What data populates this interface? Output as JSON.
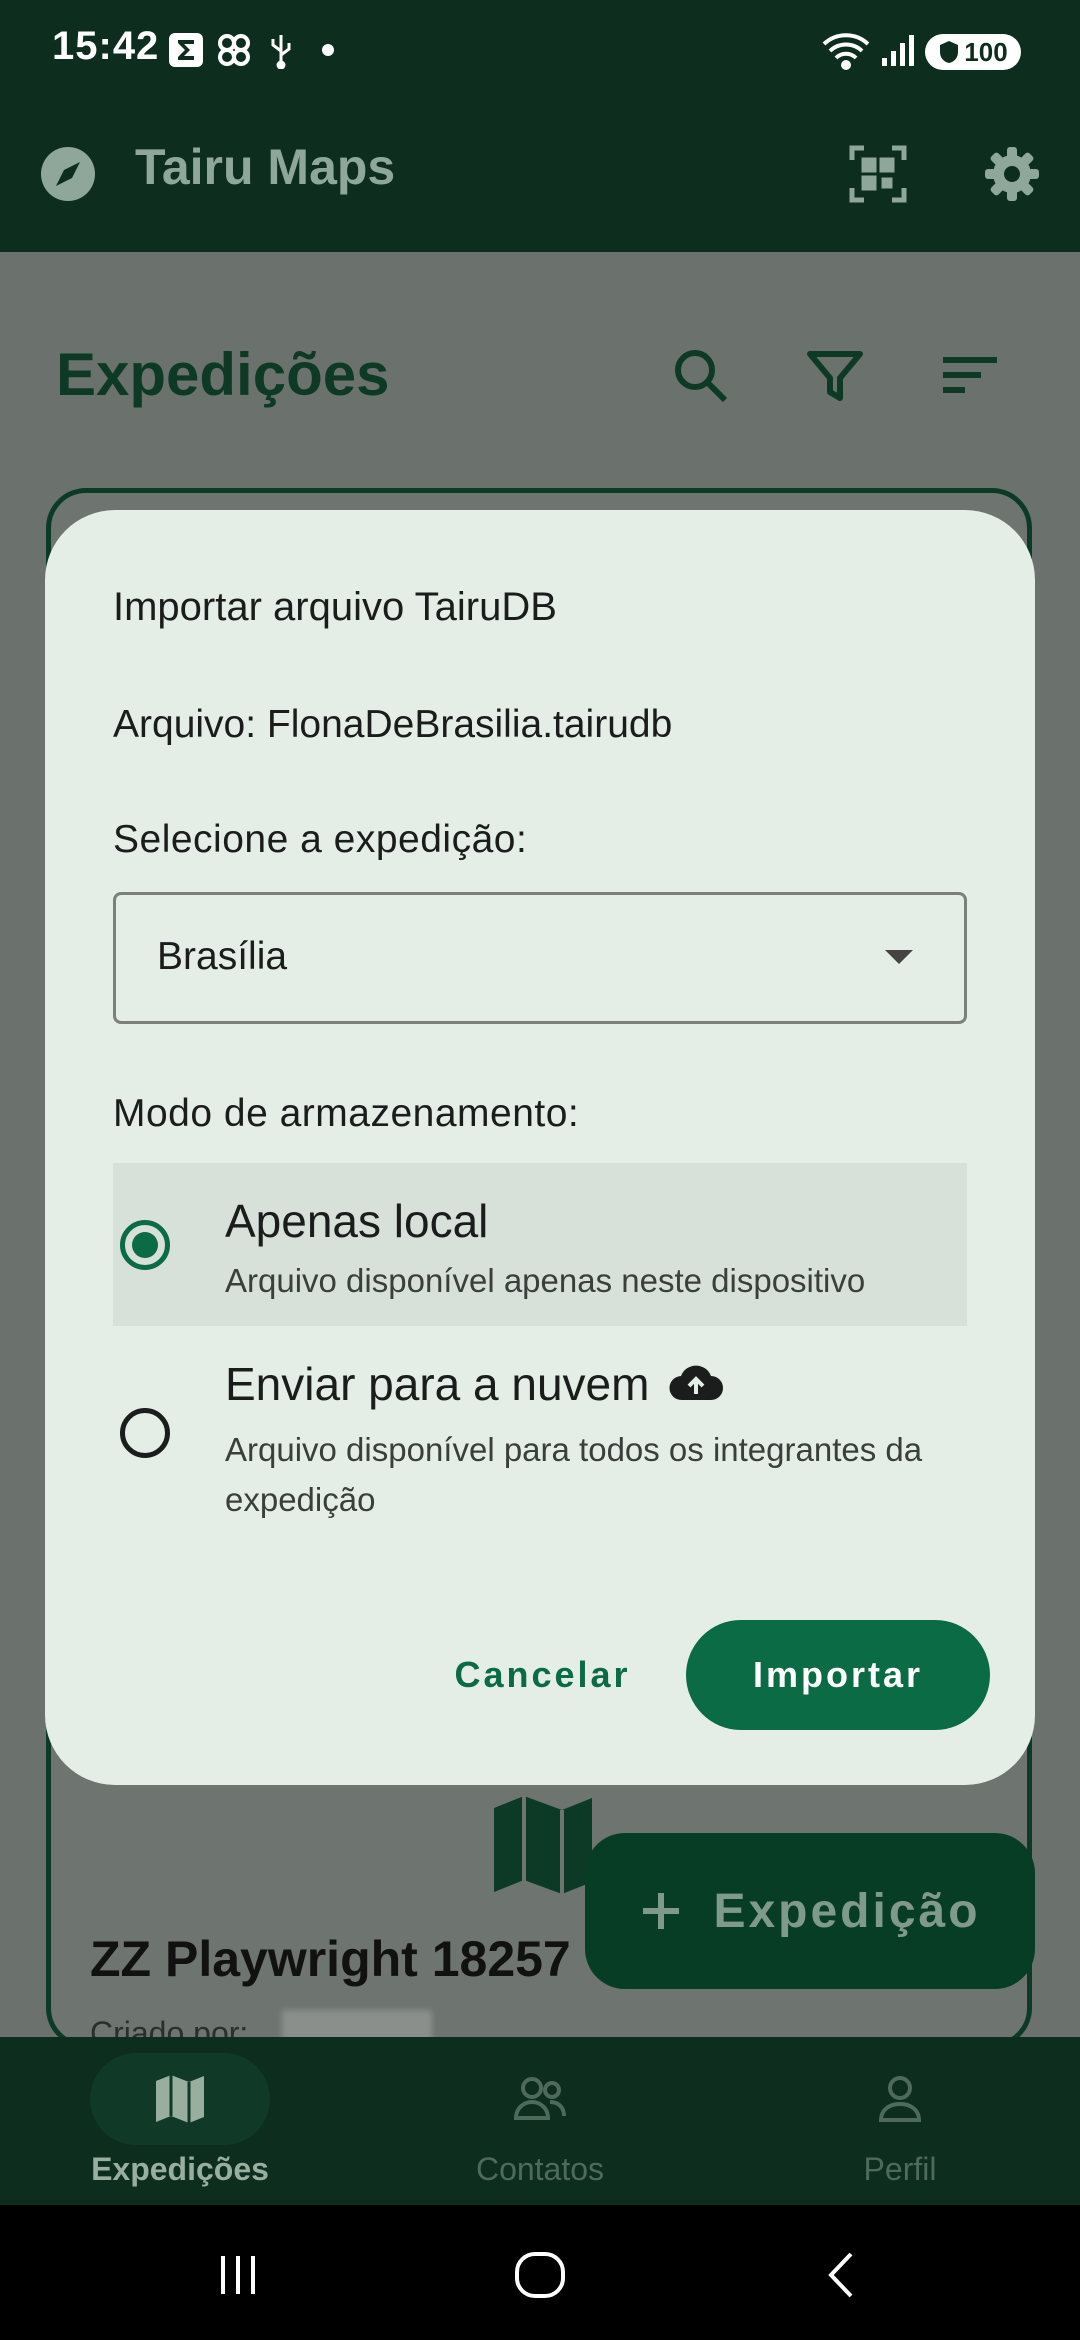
{
  "status_bar": {
    "time": "15:42",
    "battery": "100",
    "icons": [
      "sigma-icon",
      "pinwheel-icon",
      "usb-icon",
      "dot-icon",
      "wifi-icon",
      "signal-icon",
      "battery-icon"
    ]
  },
  "app_bar": {
    "title": "Tairu Maps",
    "icons": [
      "compass-icon",
      "qr-code-icon",
      "gear-icon"
    ]
  },
  "page": {
    "heading": "Expedições",
    "tools": [
      "search-icon",
      "filter-icon",
      "sort-icon"
    ],
    "card": {
      "title": "ZZ Playwright 18257",
      "created_by_label": "Criado por:"
    },
    "fab_label": "Expedição"
  },
  "dialog": {
    "title": "Importar arquivo TairuDB",
    "file_line": "Arquivo: FlonaDeBrasilia.tairudb",
    "select_label": "Selecione a expedição:",
    "select_value": "Brasília",
    "storage_label": "Modo de armazenamento:",
    "options": [
      {
        "title": "Apenas local",
        "description": "Arquivo disponível apenas neste dispositivo",
        "selected": true
      },
      {
        "title": "Enviar para a nuvem",
        "description": "Arquivo disponível para todos os integrantes da expedição",
        "selected": false
      }
    ],
    "cancel_label": "Cancelar",
    "import_label": "Importar"
  },
  "bottom_nav": {
    "items": [
      {
        "label": "Expedições",
        "icon": "map-icon",
        "active": true
      },
      {
        "label": "Contatos",
        "icon": "people-icon",
        "active": false
      },
      {
        "label": "Perfil",
        "icon": "person-icon",
        "active": false
      }
    ]
  },
  "colors": {
    "primary": "#0a6b45",
    "dark_green": "#0d2d1e",
    "dialog_bg": "#e5ede7"
  }
}
